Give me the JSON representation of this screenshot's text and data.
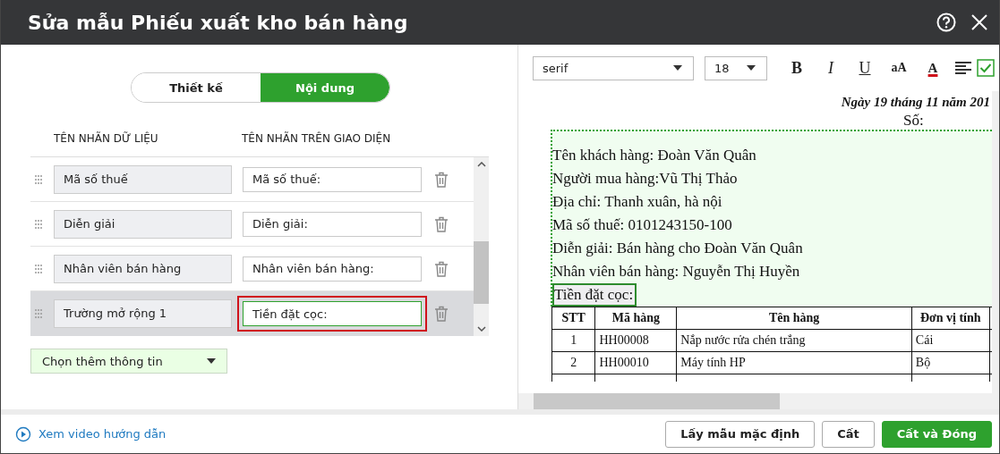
{
  "window": {
    "title": "Sửa mẫu Phiếu xuất kho bán hàng"
  },
  "tabs": [
    {
      "label": "Thiết kế",
      "selected": false
    },
    {
      "label": "Nội dung",
      "selected": true
    }
  ],
  "columns": [
    "TÊN NHÃN DỮ LIỆU",
    "TÊN NHÃN TRÊN GIAO DIỆN"
  ],
  "fields": [
    {
      "data_label": "Mã số thuế",
      "display_label": "Mã số thuế:",
      "selected": false
    },
    {
      "data_label": "Diễn giải",
      "display_label": "Diễn giải:",
      "selected": false
    },
    {
      "data_label": "Nhân viên bán hàng",
      "display_label": "Nhân viên bán hàng:",
      "selected": false
    },
    {
      "data_label": "Trường mở rộng 1",
      "display_label": "Tiền đặt cọc:",
      "selected": true
    }
  ],
  "add_dropdown": {
    "label": "Chọn thêm thông tin"
  },
  "help_link": "Xem video hướng dẫn",
  "toolbar": {
    "font": "serif",
    "size": "18",
    "format_buttons": [
      {
        "label": "B",
        "kind": "bold"
      },
      {
        "label": "I",
        "kind": "italic"
      },
      {
        "label": "U",
        "kind": "underline"
      },
      {
        "label": "aA",
        "kind": "case"
      },
      {
        "label": "A",
        "kind": "color"
      }
    ]
  },
  "document": {
    "date": "Ngày 19 tháng 11 năm 201",
    "number_label": "Số:",
    "lines": [
      {
        "text": "Tên khách hàng: Đoàn Văn Quân",
        "selected": false
      },
      {
        "text": "Người mua hàng:Vũ Thị Thảo",
        "selected": false
      },
      {
        "text": "Địa chỉ: Thanh xuân, hà nội",
        "selected": false
      },
      {
        "text": "Mã số thuế: 0101243150-100",
        "selected": false
      },
      {
        "text": "Diễn giải: Bán hàng cho Đoàn Văn Quân",
        "selected": false
      },
      {
        "text": "Nhân viên bán hàng: Nguyễn Thị Huyền",
        "selected": false
      },
      {
        "text": "Tiền đặt cọc:",
        "selected": true
      }
    ],
    "table": {
      "columns": [
        "STT",
        "Mã hàng",
        "Tên hàng",
        "Đơn vị tính"
      ],
      "rows": [
        [
          "1",
          "HH00008",
          "Nắp nước rửa chén trắng",
          "Cái"
        ],
        [
          "2",
          "HH00010",
          "Máy tính HP",
          "Bộ"
        ]
      ]
    }
  },
  "buttons": [
    {
      "label": "Lấy mẫu mặc định",
      "kind": "secondary"
    },
    {
      "label": "Cất",
      "kind": "secondary"
    },
    {
      "label": "Cất và Đóng",
      "kind": "primary"
    }
  ]
}
